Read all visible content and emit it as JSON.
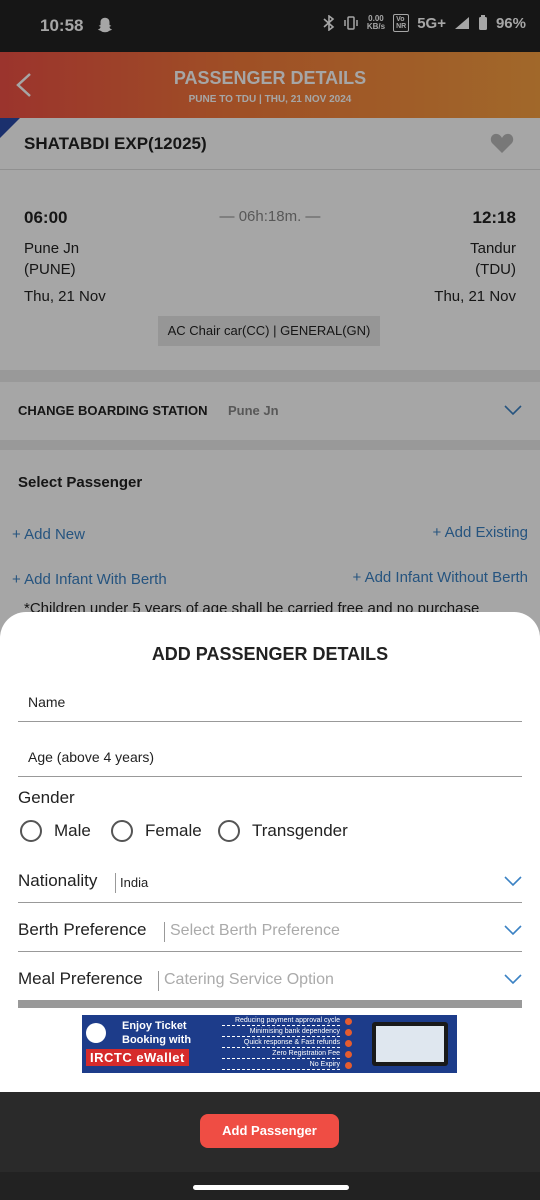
{
  "status_bar": {
    "time": "10:58",
    "speed_value": "0.00",
    "speed_unit": "KB/s",
    "network": "5G+",
    "battery": "96%"
  },
  "header": {
    "title": "PASSENGER DETAILS",
    "route": "PUNE TO TDU",
    "date": "THU, 21 NOV 2024",
    "separator": "|"
  },
  "train": {
    "name": "SHATABDI EXP(12025)"
  },
  "journey": {
    "departure_time": "06:00",
    "arrival_time": "12:18",
    "duration": "— 06h:18m. —",
    "from_station": "Pune Jn",
    "from_code": "(PUNE)",
    "to_station": "Tandur",
    "to_code": "(TDU)",
    "departure_date": "Thu, 21 Nov",
    "arrival_date": "Thu, 21 Nov",
    "class_quota": "AC Chair car(CC) | GENERAL(GN)"
  },
  "boarding": {
    "label": "CHANGE BOARDING STATION",
    "station": "Pune Jn"
  },
  "passengers": {
    "heading": "Select Passenger",
    "add_new": "+ Add New",
    "add_existing": "+ Add Existing",
    "add_infant_berth": "+ Add Infant With Berth",
    "add_infant_no_berth": "+ Add Infant Without Berth",
    "note": "*Children under 5 years of age shall be carried free and no purchase"
  },
  "sheet": {
    "title": "ADD PASSENGER DETAILS",
    "name_placeholder": "Name",
    "age_placeholder": "Age (above 4 years)",
    "gender_label": "Gender",
    "gender_options": [
      "Male",
      "Female",
      "Transgender"
    ],
    "nationality_label": "Nationality",
    "nationality_value": "India",
    "berth_label": "Berth Preference",
    "berth_placeholder": "Select Berth Preference",
    "meal_label": "Meal Preference",
    "meal_placeholder": "Catering Service Option"
  },
  "banner": {
    "line1": "Enjoy Ticket",
    "line2": "Booking with",
    "brand": "IRCTC eWallet",
    "features": [
      "Reducing payment approval cycle",
      "Minimising bank dependency",
      "Quick response & Fast refunds",
      "Zero Registration Fee",
      "No Expiry"
    ]
  },
  "action": {
    "add_passenger": "Add Passenger"
  },
  "colors": {
    "header_start": "#ef5045",
    "header_end": "#f7a041",
    "link": "#3b82c4",
    "primary_button": "#ef4d44"
  }
}
